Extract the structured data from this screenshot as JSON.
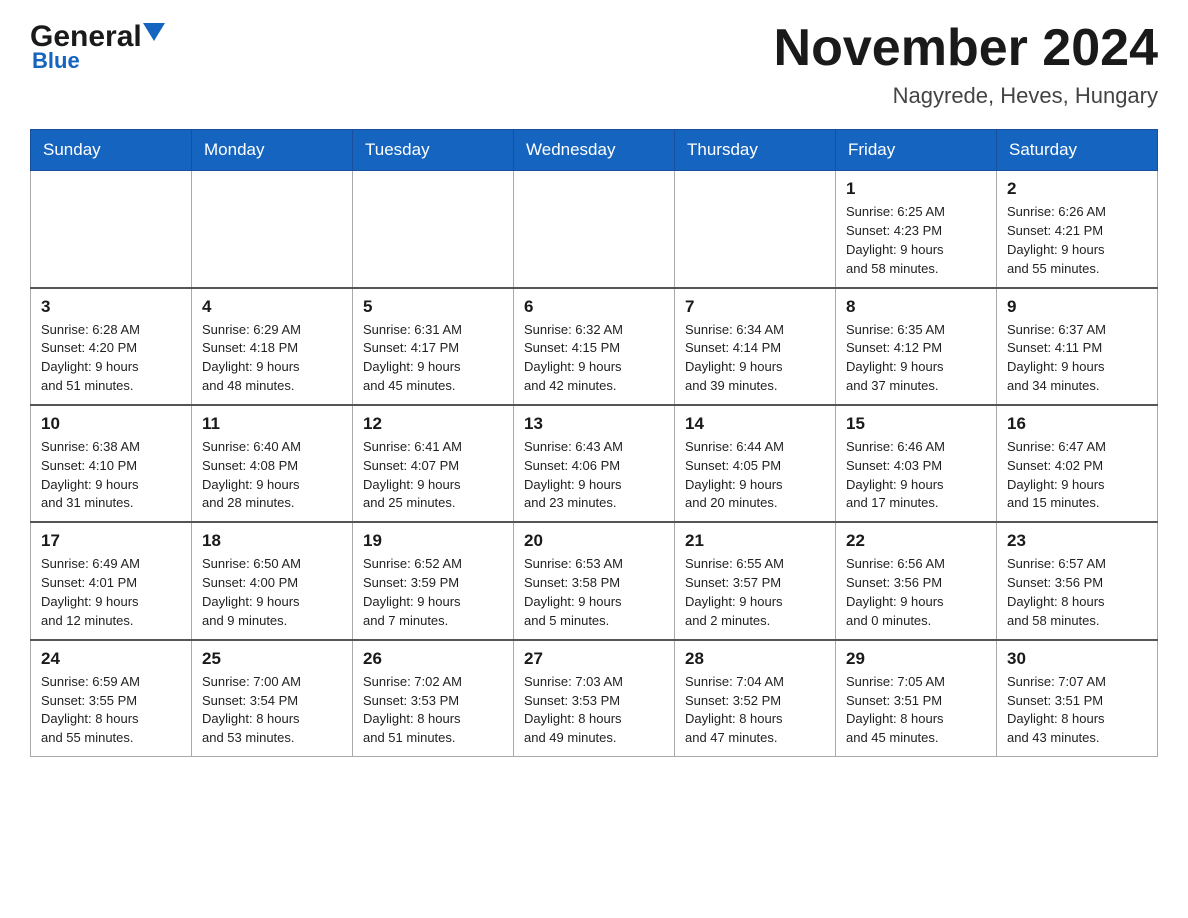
{
  "header": {
    "logo_general": "General",
    "logo_blue": "Blue",
    "title": "November 2024",
    "subtitle": "Nagyrede, Heves, Hungary"
  },
  "weekdays": [
    "Sunday",
    "Monday",
    "Tuesday",
    "Wednesday",
    "Thursday",
    "Friday",
    "Saturday"
  ],
  "weeks": [
    [
      {
        "day": "",
        "info": ""
      },
      {
        "day": "",
        "info": ""
      },
      {
        "day": "",
        "info": ""
      },
      {
        "day": "",
        "info": ""
      },
      {
        "day": "",
        "info": ""
      },
      {
        "day": "1",
        "info": "Sunrise: 6:25 AM\nSunset: 4:23 PM\nDaylight: 9 hours\nand 58 minutes."
      },
      {
        "day": "2",
        "info": "Sunrise: 6:26 AM\nSunset: 4:21 PM\nDaylight: 9 hours\nand 55 minutes."
      }
    ],
    [
      {
        "day": "3",
        "info": "Sunrise: 6:28 AM\nSunset: 4:20 PM\nDaylight: 9 hours\nand 51 minutes."
      },
      {
        "day": "4",
        "info": "Sunrise: 6:29 AM\nSunset: 4:18 PM\nDaylight: 9 hours\nand 48 minutes."
      },
      {
        "day": "5",
        "info": "Sunrise: 6:31 AM\nSunset: 4:17 PM\nDaylight: 9 hours\nand 45 minutes."
      },
      {
        "day": "6",
        "info": "Sunrise: 6:32 AM\nSunset: 4:15 PM\nDaylight: 9 hours\nand 42 minutes."
      },
      {
        "day": "7",
        "info": "Sunrise: 6:34 AM\nSunset: 4:14 PM\nDaylight: 9 hours\nand 39 minutes."
      },
      {
        "day": "8",
        "info": "Sunrise: 6:35 AM\nSunset: 4:12 PM\nDaylight: 9 hours\nand 37 minutes."
      },
      {
        "day": "9",
        "info": "Sunrise: 6:37 AM\nSunset: 4:11 PM\nDaylight: 9 hours\nand 34 minutes."
      }
    ],
    [
      {
        "day": "10",
        "info": "Sunrise: 6:38 AM\nSunset: 4:10 PM\nDaylight: 9 hours\nand 31 minutes."
      },
      {
        "day": "11",
        "info": "Sunrise: 6:40 AM\nSunset: 4:08 PM\nDaylight: 9 hours\nand 28 minutes."
      },
      {
        "day": "12",
        "info": "Sunrise: 6:41 AM\nSunset: 4:07 PM\nDaylight: 9 hours\nand 25 minutes."
      },
      {
        "day": "13",
        "info": "Sunrise: 6:43 AM\nSunset: 4:06 PM\nDaylight: 9 hours\nand 23 minutes."
      },
      {
        "day": "14",
        "info": "Sunrise: 6:44 AM\nSunset: 4:05 PM\nDaylight: 9 hours\nand 20 minutes."
      },
      {
        "day": "15",
        "info": "Sunrise: 6:46 AM\nSunset: 4:03 PM\nDaylight: 9 hours\nand 17 minutes."
      },
      {
        "day": "16",
        "info": "Sunrise: 6:47 AM\nSunset: 4:02 PM\nDaylight: 9 hours\nand 15 minutes."
      }
    ],
    [
      {
        "day": "17",
        "info": "Sunrise: 6:49 AM\nSunset: 4:01 PM\nDaylight: 9 hours\nand 12 minutes."
      },
      {
        "day": "18",
        "info": "Sunrise: 6:50 AM\nSunset: 4:00 PM\nDaylight: 9 hours\nand 9 minutes."
      },
      {
        "day": "19",
        "info": "Sunrise: 6:52 AM\nSunset: 3:59 PM\nDaylight: 9 hours\nand 7 minutes."
      },
      {
        "day": "20",
        "info": "Sunrise: 6:53 AM\nSunset: 3:58 PM\nDaylight: 9 hours\nand 5 minutes."
      },
      {
        "day": "21",
        "info": "Sunrise: 6:55 AM\nSunset: 3:57 PM\nDaylight: 9 hours\nand 2 minutes."
      },
      {
        "day": "22",
        "info": "Sunrise: 6:56 AM\nSunset: 3:56 PM\nDaylight: 9 hours\nand 0 minutes."
      },
      {
        "day": "23",
        "info": "Sunrise: 6:57 AM\nSunset: 3:56 PM\nDaylight: 8 hours\nand 58 minutes."
      }
    ],
    [
      {
        "day": "24",
        "info": "Sunrise: 6:59 AM\nSunset: 3:55 PM\nDaylight: 8 hours\nand 55 minutes."
      },
      {
        "day": "25",
        "info": "Sunrise: 7:00 AM\nSunset: 3:54 PM\nDaylight: 8 hours\nand 53 minutes."
      },
      {
        "day": "26",
        "info": "Sunrise: 7:02 AM\nSunset: 3:53 PM\nDaylight: 8 hours\nand 51 minutes."
      },
      {
        "day": "27",
        "info": "Sunrise: 7:03 AM\nSunset: 3:53 PM\nDaylight: 8 hours\nand 49 minutes."
      },
      {
        "day": "28",
        "info": "Sunrise: 7:04 AM\nSunset: 3:52 PM\nDaylight: 8 hours\nand 47 minutes."
      },
      {
        "day": "29",
        "info": "Sunrise: 7:05 AM\nSunset: 3:51 PM\nDaylight: 8 hours\nand 45 minutes."
      },
      {
        "day": "30",
        "info": "Sunrise: 7:07 AM\nSunset: 3:51 PM\nDaylight: 8 hours\nand 43 minutes."
      }
    ]
  ]
}
